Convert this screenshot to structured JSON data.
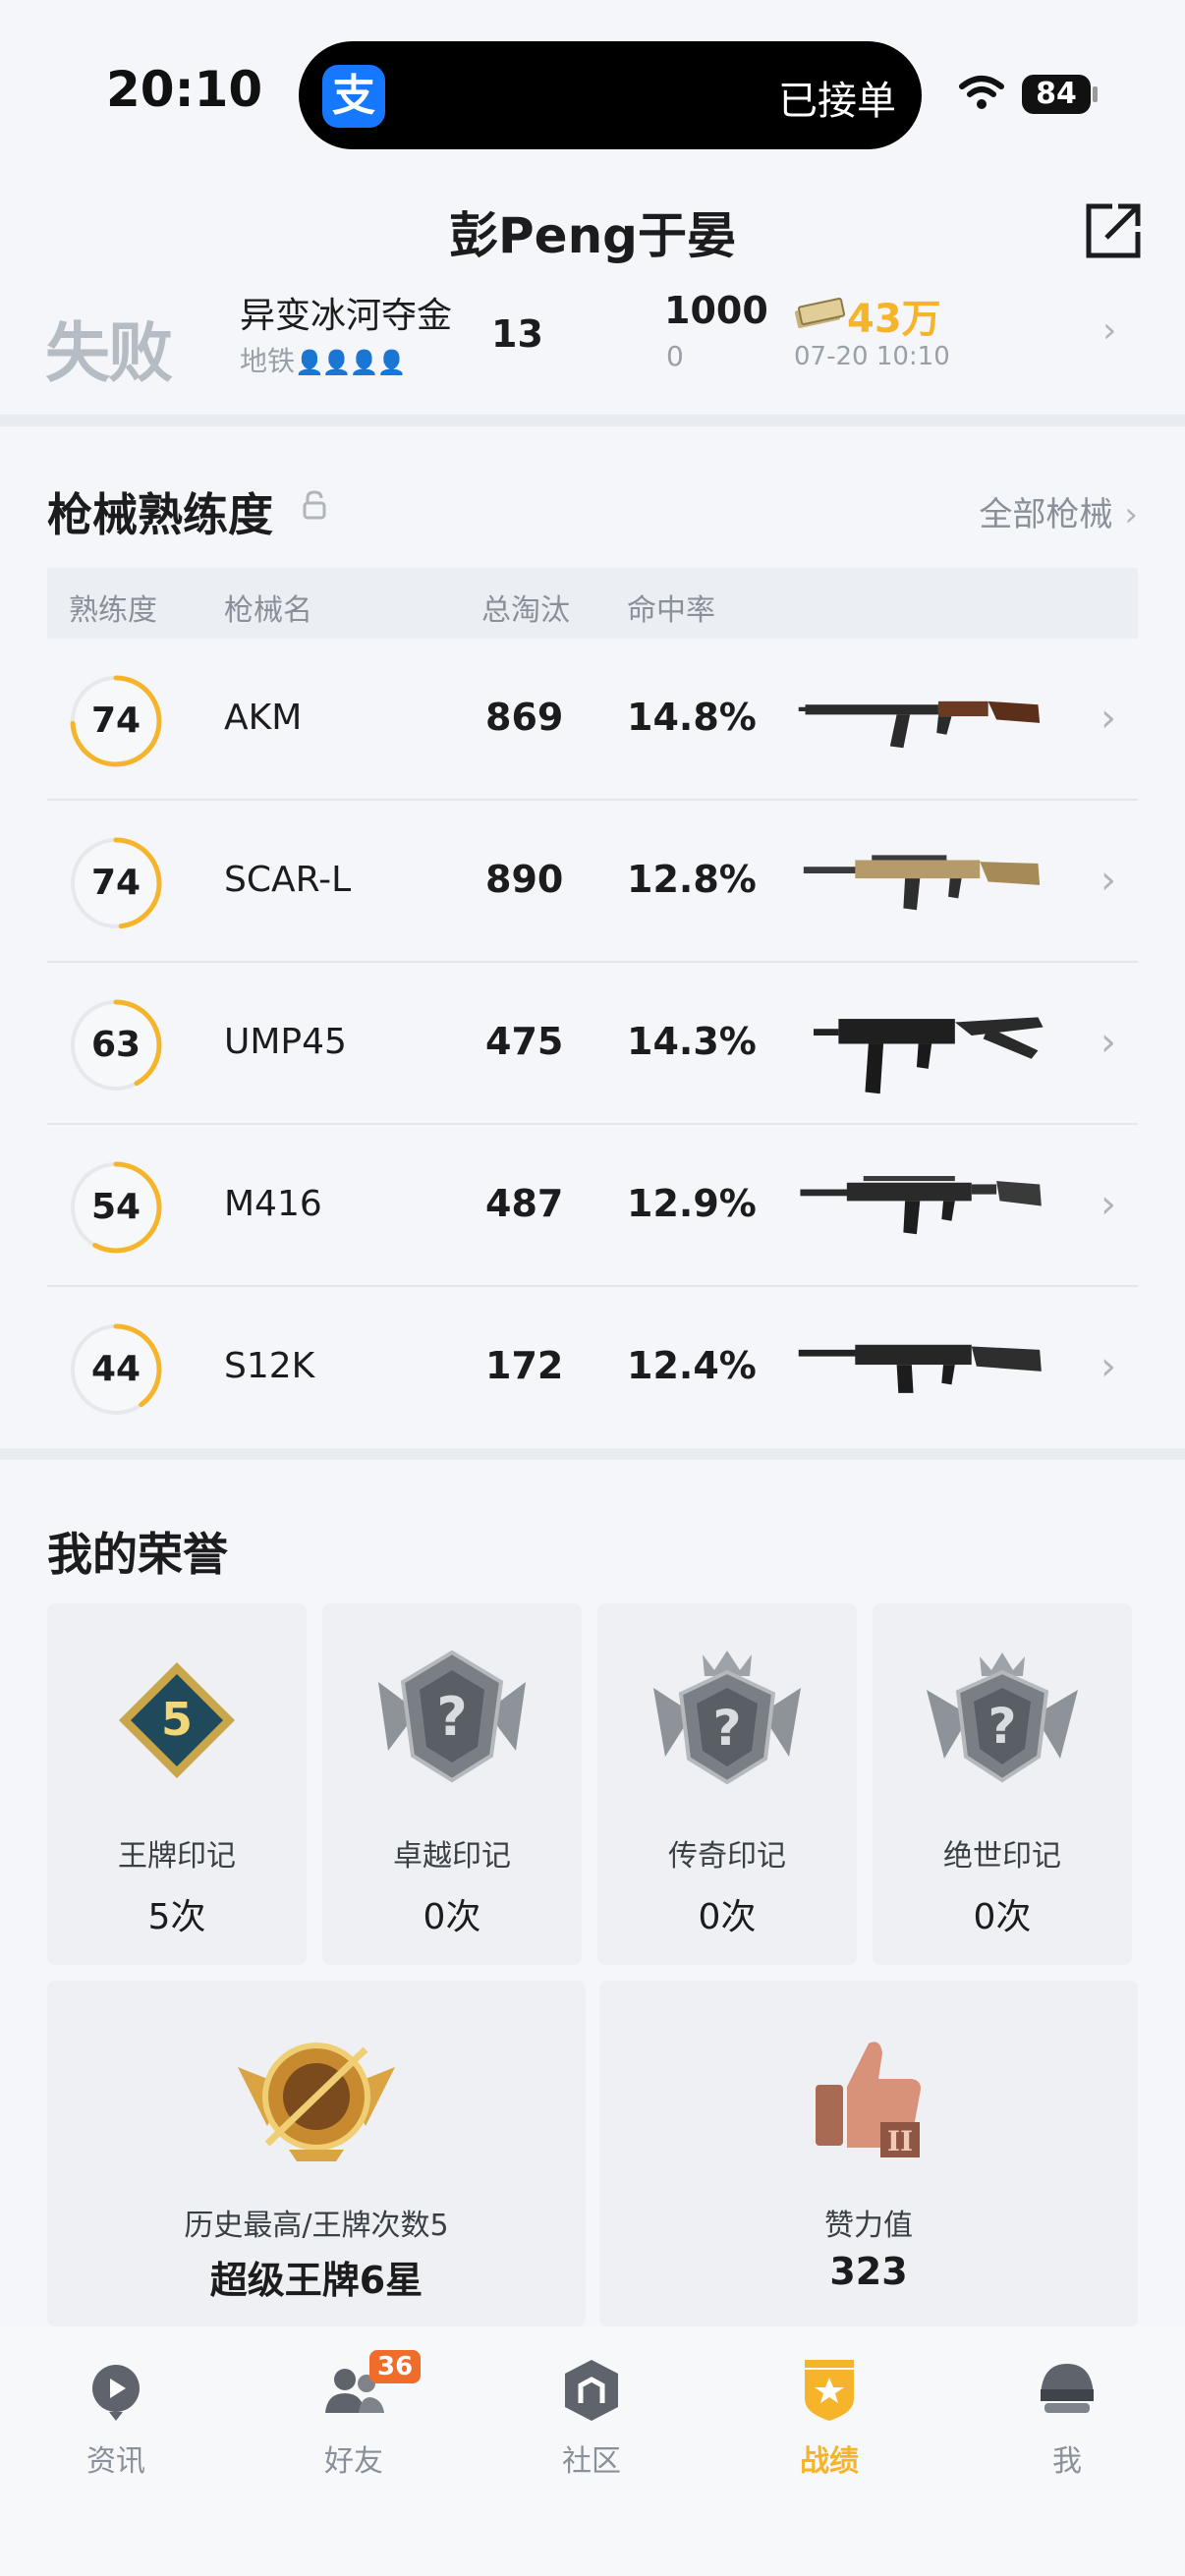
{
  "status_bar": {
    "time": "20:10",
    "island_app_icon": "支",
    "island_text": "已接单",
    "battery": "84"
  },
  "header": {
    "player_name": "彭Peng于晏"
  },
  "last_match": {
    "result": "失败",
    "map": "异变冰河夺金",
    "sub": "地铁",
    "team_icons": "👤👤👤👤",
    "rank": "13",
    "score_top": "1000",
    "score_bottom": "0",
    "money": "43万",
    "time": "07-20 10:10"
  },
  "weapons": {
    "title": "枪械熟练度",
    "all_label": "全部枪械",
    "columns": [
      "熟练度",
      "枪械名",
      "总淘汰",
      "命中率"
    ],
    "rows": [
      {
        "level": "74",
        "name": "AKM",
        "kills": "869",
        "accuracy": "14.8%",
        "progress": 0.74
      },
      {
        "level": "74",
        "name": "SCAR-L",
        "kills": "890",
        "accuracy": "12.8%",
        "progress": 0.48
      },
      {
        "level": "63",
        "name": "UMP45",
        "kills": "475",
        "accuracy": "14.3%",
        "progress": 0.42
      },
      {
        "level": "54",
        "name": "M416",
        "kills": "487",
        "accuracy": "12.9%",
        "progress": 0.58
      },
      {
        "level": "44",
        "name": "S12K",
        "kills": "172",
        "accuracy": "12.4%",
        "progress": 0.4
      }
    ]
  },
  "honors": {
    "title": "我的荣誉",
    "marks": [
      {
        "label": "王牌印记",
        "count": "5次",
        "badge_text": "5"
      },
      {
        "label": "卓越印记",
        "count": "0次",
        "badge_text": "?"
      },
      {
        "label": "传奇印记",
        "count": "0次",
        "badge_text": "?"
      },
      {
        "label": "绝世印记",
        "count": "0次",
        "badge_text": "?"
      }
    ],
    "highest": {
      "label": "历史最高/王牌次数5",
      "value": "超级王牌6星"
    },
    "likes": {
      "label": "赞力值",
      "value": "323"
    }
  },
  "tabbar": {
    "tabs": [
      {
        "label": "资讯"
      },
      {
        "label": "好友",
        "badge": "36"
      },
      {
        "label": "社区"
      },
      {
        "label": "战绩",
        "active": true
      },
      {
        "label": "我"
      }
    ]
  },
  "colors": {
    "accent": "#f5b42a",
    "ring_track": "#e6e8ec",
    "ring_fill": "#f5b42a",
    "result_gray": "#b6bcc4"
  }
}
